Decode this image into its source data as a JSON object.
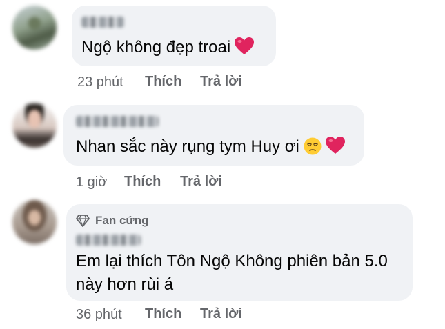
{
  "comments": [
    {
      "text": "Ngộ không đẹp troai",
      "time": "23 phút",
      "like": "Thích",
      "reply": "Trả lời",
      "reaction_icon": "red-heart-icon"
    },
    {
      "text": "Nhan sắc này rụng tym Huy ơi",
      "time": "1 giờ",
      "like": "Thích",
      "reply": "Trả lời",
      "reaction_icons": [
        "unamused-face-icon",
        "red-heart-icon"
      ]
    },
    {
      "badge": "Fan cứng",
      "badge_icon": "diamond-icon",
      "text_line1": "Em lại thích Tôn Ngộ Không phiên bản 5.0",
      "text_line2": "này hơn rùi á",
      "time": "36 phút",
      "like": "Thích",
      "reply": "Trả lời"
    }
  ],
  "colors": {
    "bubble": "#f0f2f5",
    "text": "#050505",
    "meta": "#65676b",
    "heart": "#e0245e"
  }
}
